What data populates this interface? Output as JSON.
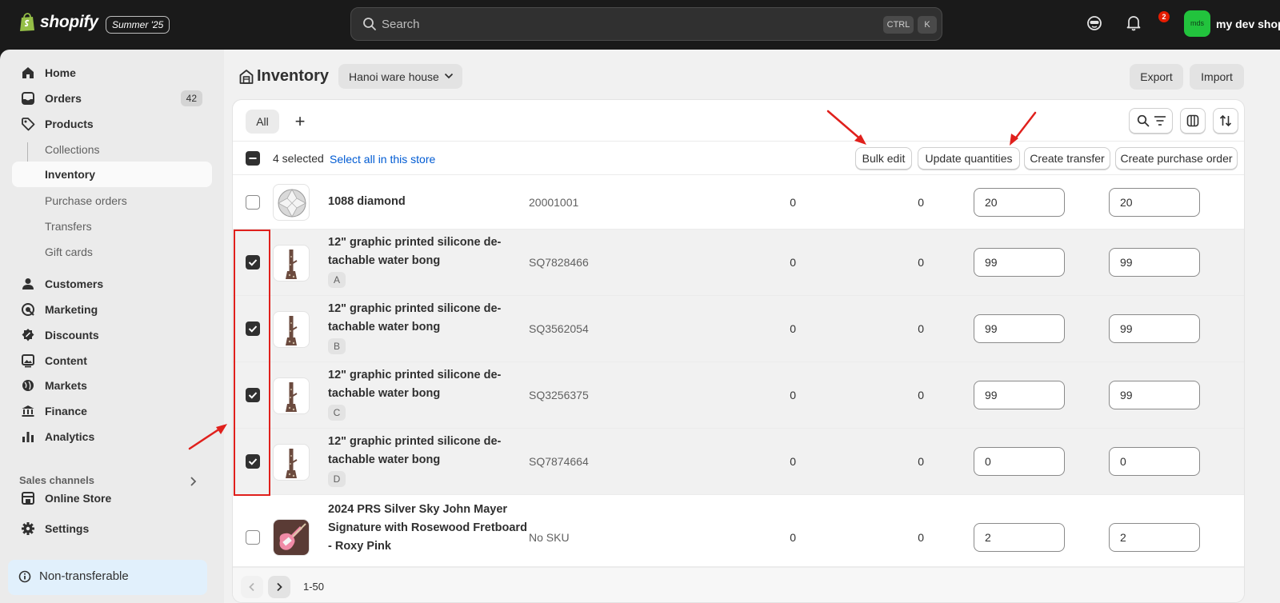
{
  "topbar": {
    "brand": "shopify",
    "edition": "Summer '25",
    "search": {
      "placeholder": "Search",
      "shortcut_ctrl": "CTRL",
      "shortcut_key": "K"
    },
    "notification_count": "2",
    "avatar_initials": "mds",
    "shop_name": "my dev shop"
  },
  "sidebar": {
    "items": [
      {
        "label": "Home",
        "icon": "home-icon"
      },
      {
        "label": "Orders",
        "icon": "inbox-icon",
        "badge": "42"
      },
      {
        "label": "Products",
        "icon": "tag-icon"
      },
      {
        "label": "Collections"
      },
      {
        "label": "Inventory"
      },
      {
        "label": "Purchase orders"
      },
      {
        "label": "Transfers"
      },
      {
        "label": "Gift cards"
      },
      {
        "label": "Customers",
        "icon": "person-icon"
      },
      {
        "label": "Marketing",
        "icon": "target-icon"
      },
      {
        "label": "Discounts",
        "icon": "discount-icon"
      },
      {
        "label": "Content",
        "icon": "image-icon"
      },
      {
        "label": "Markets",
        "icon": "globe-icon"
      },
      {
        "label": "Finance",
        "icon": "bank-icon"
      },
      {
        "label": "Analytics",
        "icon": "bar-chart-icon"
      }
    ],
    "sales_channels_label": "Sales channels",
    "online_store": "Online Store",
    "settings": "Settings",
    "footer_banner": "Non-transferable"
  },
  "page": {
    "title": "Inventory",
    "location": "Hanoi ware house",
    "export_label": "Export",
    "import_label": "Import"
  },
  "table": {
    "tab_all": "All",
    "tab_add": "+",
    "selected_count": "4 selected",
    "select_all": "Select all in this store",
    "bulk_actions": [
      "Bulk edit",
      "Update quantities",
      "Create transfer",
      "Create purchase order"
    ],
    "rows": [
      {
        "name": "1088 diamond",
        "variant": "",
        "sku": "20001001",
        "col3": "0",
        "col4": "0",
        "qty1": "20",
        "qty2": "20",
        "selected": false
      },
      {
        "name": "12\" graphic printed silicone de-tachable water bong",
        "variant": "A",
        "sku": "SQ7828466",
        "col3": "0",
        "col4": "0",
        "qty1": "99",
        "qty2": "99",
        "selected": true
      },
      {
        "name": "12\" graphic printed silicone de-tachable water bong",
        "variant": "B",
        "sku": "SQ3562054",
        "col3": "0",
        "col4": "0",
        "qty1": "99",
        "qty2": "99",
        "selected": true
      },
      {
        "name": "12\" graphic printed silicone de-tachable water bong",
        "variant": "C",
        "sku": "SQ3256375",
        "col3": "0",
        "col4": "0",
        "qty1": "99",
        "qty2": "99",
        "selected": true
      },
      {
        "name": "12\" graphic printed silicone de-tachable water bong",
        "variant": "D",
        "sku": "SQ7874664",
        "col3": "0",
        "col4": "0",
        "qty1": "0",
        "qty2": "0",
        "selected": true
      },
      {
        "name": "2024 PRS Silver Sky John Mayer Signature with Rosewood Fretboard - Roxy Pink",
        "variant": "",
        "sku": "No SKU",
        "col3": "0",
        "col4": "0",
        "qty1": "2",
        "qty2": "2",
        "selected": false
      }
    ],
    "pagination": "1-50"
  },
  "colors": {
    "topbar_bg": "#1a1a1a",
    "sidebar_bg": "#ebebeb",
    "link_blue": "#005bd3",
    "annotation_red": "#e0201c",
    "avatar_green": "#22c33d"
  }
}
